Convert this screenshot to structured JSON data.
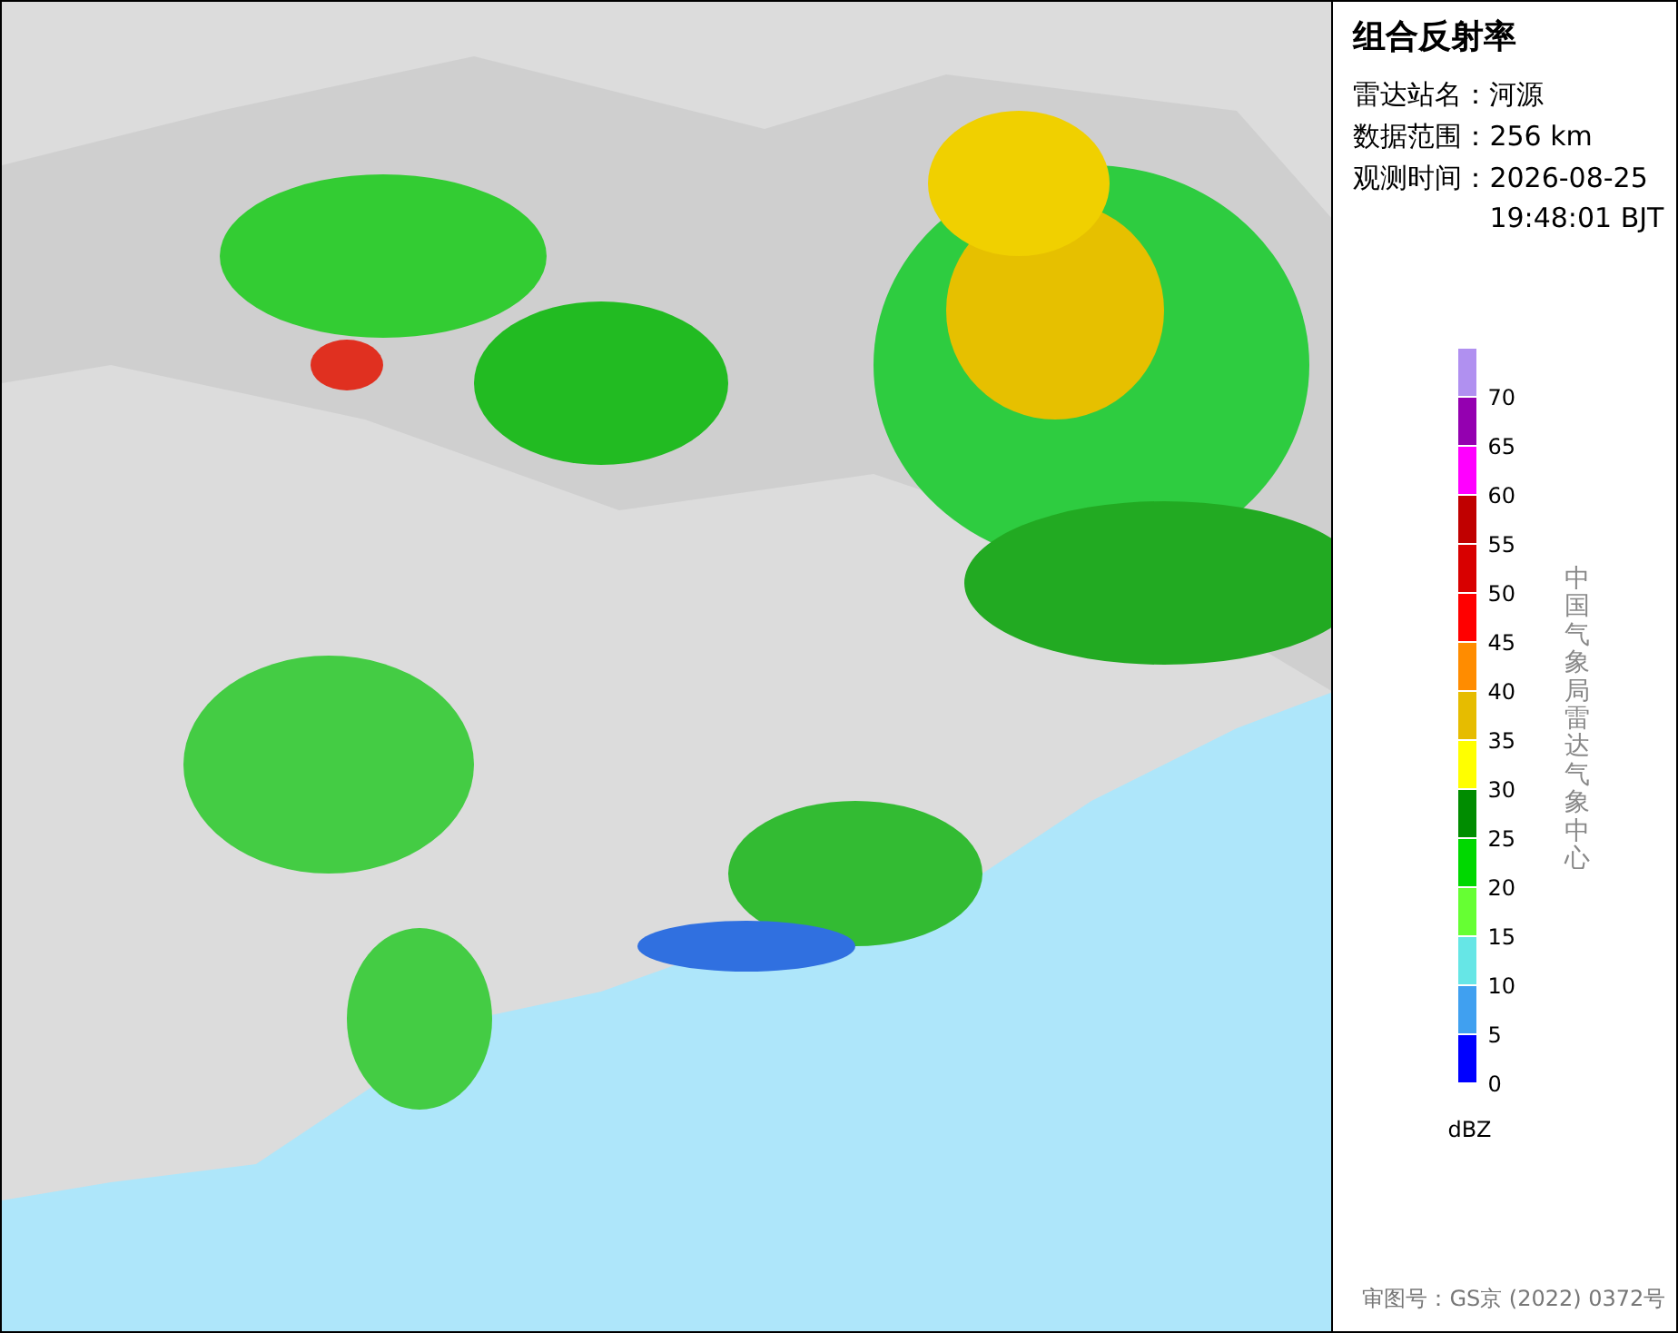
{
  "panel": {
    "title": "组合反射率",
    "fields": [
      {
        "label": "雷达站名：",
        "value": "河源"
      },
      {
        "label": "数据范围：",
        "value": "256 km"
      },
      {
        "label": "观测时间：",
        "value": "2026-08-25\n19:48:01 BJT"
      }
    ],
    "legend": {
      "bins": [
        {
          "color": "#b090f0",
          "label": "70"
        },
        {
          "color": "#9400b0",
          "label": "65"
        },
        {
          "color": "#ff00ff",
          "label": "60"
        },
        {
          "color": "#c00000",
          "label": "55"
        },
        {
          "color": "#d80000",
          "label": "50"
        },
        {
          "color": "#ff0000",
          "label": "45"
        },
        {
          "color": "#ff8c00",
          "label": "40"
        },
        {
          "color": "#e6bc00",
          "label": "35"
        },
        {
          "color": "#ffff00",
          "label": "30"
        },
        {
          "color": "#008c00",
          "label": "25"
        },
        {
          "color": "#00d800",
          "label": "20"
        },
        {
          "color": "#66ff33",
          "label": "15"
        },
        {
          "color": "#66e6e6",
          "label": "10"
        },
        {
          "color": "#40a0f0",
          "label": "5"
        },
        {
          "color": "#0000ff",
          "label": "0"
        }
      ],
      "unit": "dBZ"
    },
    "credit": "中国气象局雷达气象中心",
    "approval": "审图号：GS京 (2022) 0372号"
  }
}
